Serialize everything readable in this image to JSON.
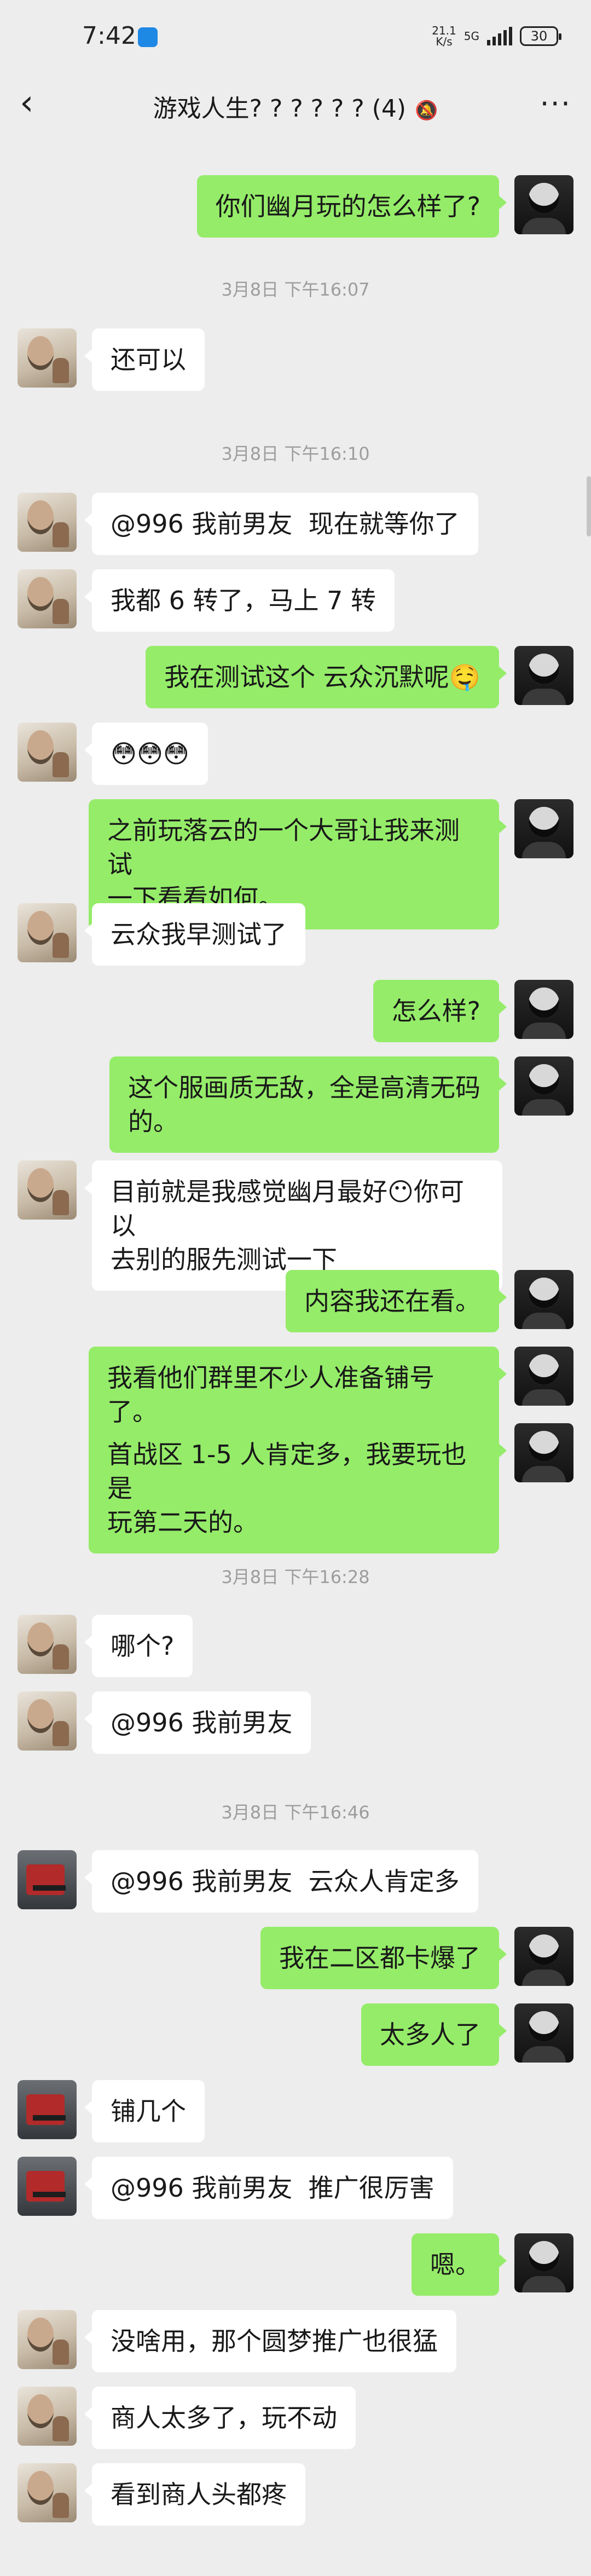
{
  "status_bar": {
    "time": "7:42",
    "net_speed_top": "21.1",
    "net_speed_unit": "K/s",
    "network": "5G",
    "battery": "30"
  },
  "header": {
    "back_icon": "chevron-left-icon",
    "title": "游戏人生? ? ? ? ? ? (4)",
    "mute_icon": "bell-slash-icon",
    "more_icon": "ellipsis-icon"
  },
  "timestamps": [
    "3月8日 下午16:07",
    "3月8日 下午16:10",
    "3月8日 下午16:28",
    "3月8日 下午16:46"
  ],
  "messages": [
    {
      "side": "right",
      "avatar": "b",
      "text": "你们幽月玩的怎么样了?"
    },
    {
      "side": "left",
      "avatar": "a",
      "text": "还可以"
    },
    {
      "side": "left",
      "avatar": "a",
      "text": "@996 我前男友  现在就等你了"
    },
    {
      "side": "left",
      "avatar": "a",
      "text": "我都 6 转了，马上 7 转"
    },
    {
      "side": "right",
      "avatar": "b",
      "text": "我在测试这个 云众沉默呢🤤"
    },
    {
      "side": "left",
      "avatar": "a",
      "text": "😳😳😳"
    },
    {
      "side": "right",
      "avatar": "b",
      "text": "之前玩落云的一个大哥让我来测试\n一下看看如何。"
    },
    {
      "side": "left",
      "avatar": "a",
      "text": "云众我早测试了"
    },
    {
      "side": "right",
      "avatar": "b",
      "text": "怎么样?"
    },
    {
      "side": "right",
      "avatar": "b",
      "text": "这个服画质无敌，全是高清无码\n的。"
    },
    {
      "side": "left",
      "avatar": "a",
      "text": "目前就是我感觉幽月最好😶你可以\n去别的服先测试一下"
    },
    {
      "side": "right",
      "avatar": "b",
      "text": "内容我还在看。"
    },
    {
      "side": "right",
      "avatar": "b",
      "text": "我看他们群里不少人准备铺号了。"
    },
    {
      "side": "right",
      "avatar": "b",
      "text": "首战区 1-5 人肯定多，我要玩也是\n玩第二天的。"
    },
    {
      "side": "left",
      "avatar": "a",
      "text": "哪个?"
    },
    {
      "side": "left",
      "avatar": "a",
      "text": "@996 我前男友"
    },
    {
      "side": "left",
      "avatar": "c",
      "text": "@996 我前男友  云众人肯定多"
    },
    {
      "side": "right",
      "avatar": "b",
      "text": "我在二区都卡爆了"
    },
    {
      "side": "right",
      "avatar": "b",
      "text": "太多人了"
    },
    {
      "side": "left",
      "avatar": "c",
      "text": "铺几个"
    },
    {
      "side": "left",
      "avatar": "c",
      "text": "@996 我前男友  推广很厉害"
    },
    {
      "side": "right",
      "avatar": "b",
      "text": "嗯。"
    },
    {
      "side": "left",
      "avatar": "a",
      "text": "没啥用，那个圆梦推广也很猛"
    },
    {
      "side": "left",
      "avatar": "a",
      "text": "商人太多了，玩不动"
    },
    {
      "side": "left",
      "avatar": "a",
      "text": "看到商人头都疼"
    }
  ]
}
